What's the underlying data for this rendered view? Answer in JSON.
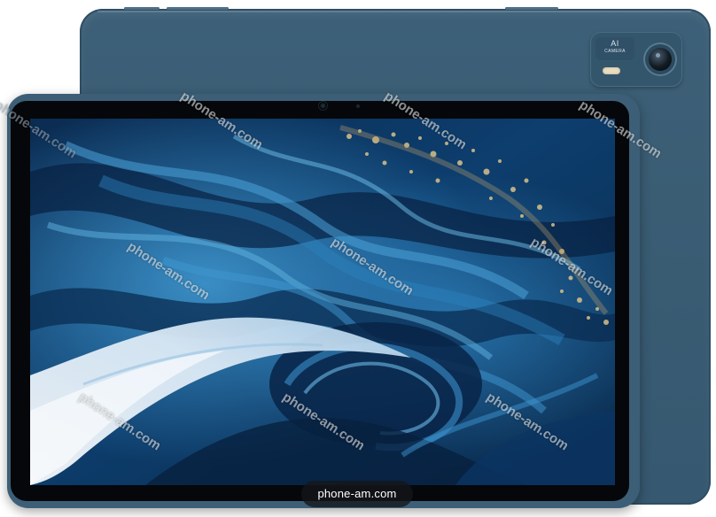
{
  "image": {
    "subject": "tablet product photo",
    "colors": {
      "body": "#3b5e76",
      "screen_deep": "#061a34",
      "screen_mid": "#0e4f86",
      "screen_light": "#3d8fc4",
      "wave_white": "#e8f2fa",
      "city_lights": "#d9c08a"
    }
  },
  "camera_module": {
    "badge_title": "AI",
    "badge_subtitle": "CAMERA",
    "icons": [
      "flash-icon",
      "camera-lens-icon"
    ]
  },
  "watermark": {
    "text": "phone-am.com",
    "credit": "phone-am.com"
  }
}
